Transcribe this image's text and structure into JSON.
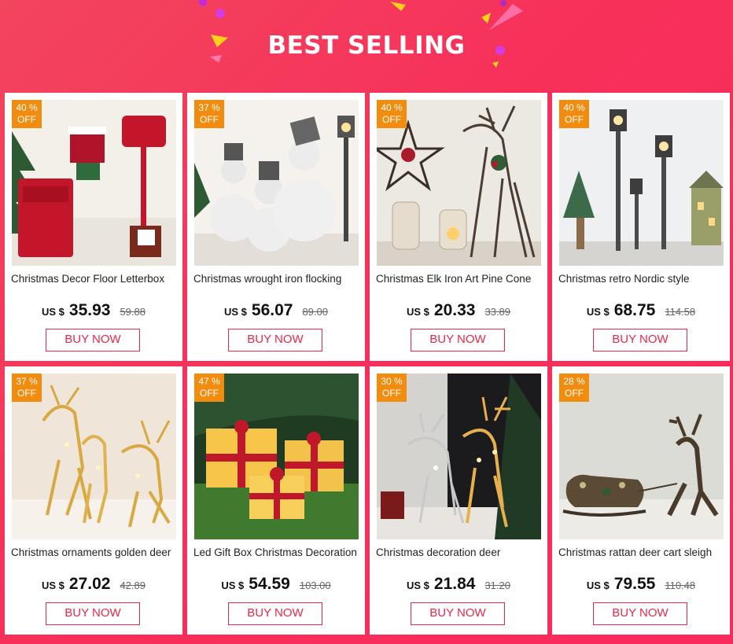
{
  "header": {
    "title": "BEST SELLING"
  },
  "colors": {
    "background": "#f7305a",
    "badge": "#f28c0e",
    "accent": "#e8294a"
  },
  "products": [
    {
      "discount": "40 %",
      "off": "OFF",
      "name": "Christmas Decor Floor Letterbox",
      "currency": "US $",
      "price": "35.93",
      "old_price": "59.88",
      "buy": "BUY NOW",
      "image": "red-mailbox-scene"
    },
    {
      "discount": "37 %",
      "off": "OFF",
      "name": "Christmas wrought iron flocking",
      "currency": "US $",
      "price": "56.07",
      "old_price": "89.00",
      "buy": "BUY NOW",
      "image": "snowmen-scene"
    },
    {
      "discount": "40 %",
      "off": "OFF",
      "name": "Christmas Elk Iron Art Pine Cone",
      "currency": "US $",
      "price": "20.33",
      "old_price": "33.89",
      "buy": "BUY NOW",
      "image": "elk-star-scene"
    },
    {
      "discount": "40 %",
      "off": "OFF",
      "name": "Christmas retro Nordic style",
      "currency": "US $",
      "price": "68.75",
      "old_price": "114.58",
      "buy": "BUY NOW",
      "image": "street-lamps-scene"
    },
    {
      "discount": "37 %",
      "off": "OFF",
      "name": "Christmas ornaments golden deer",
      "currency": "US $",
      "price": "27.02",
      "old_price": "42.89",
      "buy": "BUY NOW",
      "image": "golden-deer-scene"
    },
    {
      "discount": "47 %",
      "off": "OFF",
      "name": "Led Gift Box Christmas Decoration",
      "currency": "US $",
      "price": "54.59",
      "old_price": "103.00",
      "buy": "BUY NOW",
      "image": "gift-boxes-scene"
    },
    {
      "discount": "30 %",
      "off": "OFF",
      "name": "Christmas decoration deer",
      "currency": "US $",
      "price": "21.84",
      "old_price": "31.20",
      "buy": "BUY NOW",
      "image": "lit-deer-scene"
    },
    {
      "discount": "28 %",
      "off": "OFF",
      "name": "Christmas rattan deer cart sleigh",
      "currency": "US $",
      "price": "79.55",
      "old_price": "110.48",
      "buy": "BUY NOW",
      "image": "rattan-sleigh-scene"
    }
  ]
}
